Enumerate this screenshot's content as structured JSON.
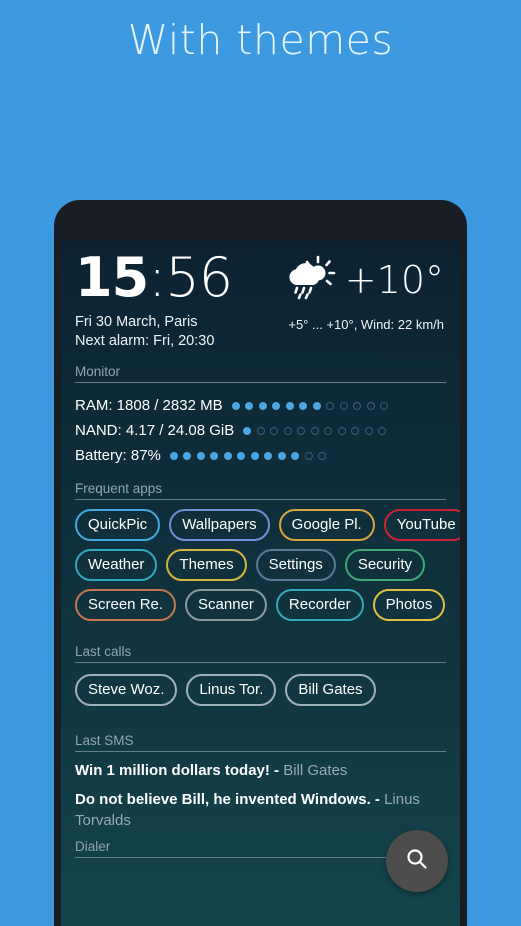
{
  "promo": {
    "title": "With themes"
  },
  "widget": {
    "clock": {
      "hours": "15",
      "separator": ":",
      "minutes": "56",
      "date_location": "Fri 30 March, Paris",
      "next_alarm": "Next alarm: Fri, 20:30"
    },
    "weather": {
      "icon": "sun-behind-rain-cloud-icon",
      "temperature": "+10°",
      "details": "+5° ... +10°, Wind: 22 km/h"
    },
    "monitor": {
      "label": "Monitor",
      "rows": [
        {
          "text": "RAM: 1808 / 2832 MB",
          "dots_total": 12,
          "dots_filled": 7
        },
        {
          "text": "NAND: 4.17 / 24.08 GiB",
          "dots_total": 11,
          "dots_filled": 1
        },
        {
          "text": "Battery: 87%",
          "dots_total": 12,
          "dots_filled": 10
        }
      ],
      "dot_on_color": "#4aa6e4",
      "dot_off_color": "#35617f"
    },
    "frequent_apps": {
      "label": "Frequent apps",
      "rows": [
        [
          {
            "label": "QuickPic",
            "color": "#45a8e0"
          },
          {
            "label": "Wallpapers",
            "color": "#6f8fd8"
          },
          {
            "label": "Google Pl.",
            "color": "#d4a63c"
          },
          {
            "label": "YouTube",
            "color": "#cc2233"
          }
        ],
        [
          {
            "label": "Weather",
            "color": "#2fa8c4"
          },
          {
            "label": "Themes",
            "color": "#d4b63c"
          },
          {
            "label": "Settings",
            "color": "#5a7a96"
          },
          {
            "label": "Security",
            "color": "#3fa876"
          }
        ],
        [
          {
            "label": "Screen Re.",
            "color": "#c4764f"
          },
          {
            "label": "Scanner",
            "color": "#8c9aa0"
          },
          {
            "label": "Recorder",
            "color": "#34a8b8"
          },
          {
            "label": "Photos",
            "color": "#ddc13c"
          }
        ]
      ]
    },
    "last_calls": {
      "label": "Last calls",
      "chips": [
        {
          "label": "Steve Woz.",
          "color": "#9fb0b8"
        },
        {
          "label": "Linus Tor.",
          "color": "#9fb0b8"
        },
        {
          "label": "Bill Gates",
          "color": "#9fb0b8"
        }
      ]
    },
    "last_sms": {
      "label": "Last SMS",
      "messages": [
        {
          "text": "Win 1 million dollars today! -",
          "sender": "Bill Gates"
        },
        {
          "text": "Do not believe Bill, he invented Windows. -",
          "sender": "Linus Torvalds"
        }
      ]
    },
    "dialer": {
      "label": "Dialer"
    },
    "fab": {
      "icon": "search-icon"
    }
  },
  "colors": {
    "promo_background": "#3d9ae0",
    "phone_frame": "#191e24",
    "widget_top": "#0c2233",
    "widget_bottom": "#13444c",
    "fab": "#4d4d4d"
  }
}
